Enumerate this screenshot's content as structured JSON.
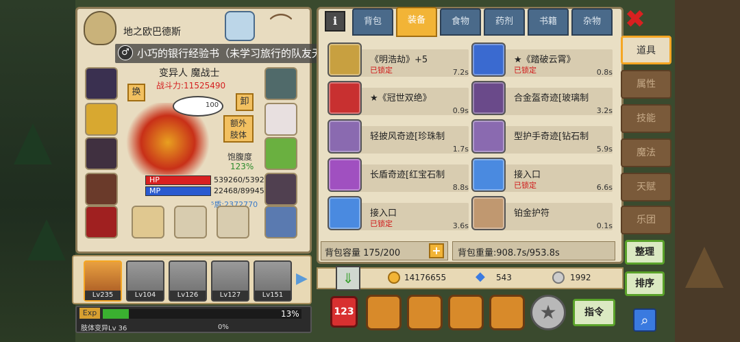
{
  "hero": {
    "title": "地之欧巴德斯",
    "notice": "小巧的银行经验书（未学习旅行的队友无经验）",
    "class_name": "变异人 魔战士",
    "power": "战斗力:11525490",
    "swap_label": "换",
    "unequip_label": "卸",
    "extra_limb_label": "额外\n肢体",
    "satiety_label": "饱腹度",
    "satiety_value": "123%",
    "hp_label": "HP",
    "hp_value": "539260/5392",
    "mp_label": "MP",
    "mp_value": "22468/89945",
    "shield_value": "⁵盾:2372770",
    "bubble_value": "100"
  },
  "team": [
    {
      "level": "Lv235"
    },
    {
      "level": "Lv104"
    },
    {
      "level": "Lv126"
    },
    {
      "level": "Lv127"
    },
    {
      "level": "Lv151"
    }
  ],
  "exp": {
    "label": "Exp",
    "percent": "13%",
    "fill": 0.13,
    "sub_label": "肢体变异Lv 36",
    "sub_percent": "0%"
  },
  "bag": {
    "tabs": [
      "背包",
      "装备",
      "食物",
      "药剂",
      "书籍",
      "杂物"
    ],
    "active_tab": "装备",
    "info_icon": "i",
    "items": [
      {
        "name": "《明浩劫》+5",
        "lock": "已锁定",
        "time": "7.2s",
        "color": "#c8a040"
      },
      {
        "name": "★《踏破云霄》",
        "lock": "已锁定",
        "time": "0.8s",
        "color": "#3a6ad0"
      },
      {
        "name": "★《冠世双绝》",
        "lock": "",
        "time": "0.9s",
        "color": "#c83030"
      },
      {
        "name": "合金盔奇迹[玻璃制",
        "lock": "",
        "time": "3.2s",
        "color": "#6a4a8a"
      },
      {
        "name": "轻披风奇迹[珍珠制",
        "lock": "",
        "time": "1.7s",
        "color": "#8a6ab0"
      },
      {
        "name": "型护手奇迹[钻石制",
        "lock": "",
        "time": "5.9s",
        "color": "#8a6ab0"
      },
      {
        "name": "长盾奇迹[红宝石制",
        "lock": "",
        "time": "8.8s",
        "color": "#a050c0"
      },
      {
        "name": "接入口",
        "lock": "已锁定",
        "time": "6.6s",
        "color": "#4a8ae0"
      },
      {
        "name": "接入口",
        "lock": "已锁定",
        "time": "3.6s",
        "color": "#4a8ae0"
      },
      {
        "name": "铂金护符",
        "lock": "",
        "time": "0.1s",
        "color": "#c09870"
      }
    ],
    "capacity": "背包容量 175/200",
    "weight": "背包重量:908.7s/953.8s"
  },
  "currency": {
    "gold": "14176655",
    "diamond": "543",
    "silver": "1992"
  },
  "side_tabs": [
    "道具",
    "属性",
    "技能",
    "魔法",
    "天赋",
    "乐团"
  ],
  "buttons": {
    "sort": "整理",
    "order": "排序",
    "command": "指令"
  }
}
